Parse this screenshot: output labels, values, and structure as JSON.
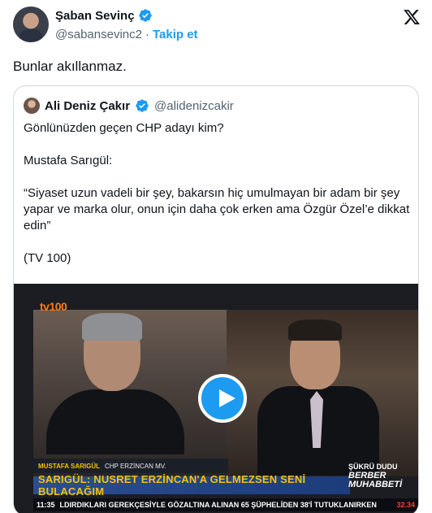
{
  "tweet": {
    "author_name": "Şaban Sevinç",
    "author_handle": "@sabansevinc2",
    "separator": "·",
    "follow_label": "Takip et",
    "text": "Bunlar akıllanmaz."
  },
  "quoted": {
    "author_name": "Ali Deniz Çakır",
    "author_handle": "@alidenizcakir",
    "paragraphs": [
      "Gönlünüzden geçen CHP adayı kim?",
      "Mustafa Sarıgül:",
      "“Siyaset uzun vadeli bir şey, bakarsın hiç umulmayan bir adam bir şey yapar ve marka olur, onun için daha çok erken ama Özgür Özel’e dikkat edin”",
      "(TV 100)"
    ]
  },
  "video": {
    "channel_logo": "tv100",
    "lower_third_name": "MUSTAFA SARIGÜL",
    "lower_third_sub": "CHP ERZİNCAN MV.",
    "headline": "SARIGÜL: NUSRET ERZİNCAN'A GELMEZSEN SENİ BULACAĞIM",
    "brand_line1": "ŞÜKRÜ DUDU",
    "brand_line2": "BERBER MUHABBETİ",
    "ticker_time": "11:35",
    "ticker_text": "LDIRDIKLARI GEREKÇESİYLE GÖZALTINA ALINAN 65 ŞÜPHELİDEN 38'İ TUTUKLANIRKEN",
    "ticker_price": "32.34"
  },
  "icons": {
    "verified": "verified-badge-icon",
    "x_logo": "x-logo-icon",
    "play": "play-icon"
  },
  "colors": {
    "accent": "#1d9bf0",
    "text": "#0f1419",
    "muted": "#536471",
    "border": "#cfd9de"
  }
}
